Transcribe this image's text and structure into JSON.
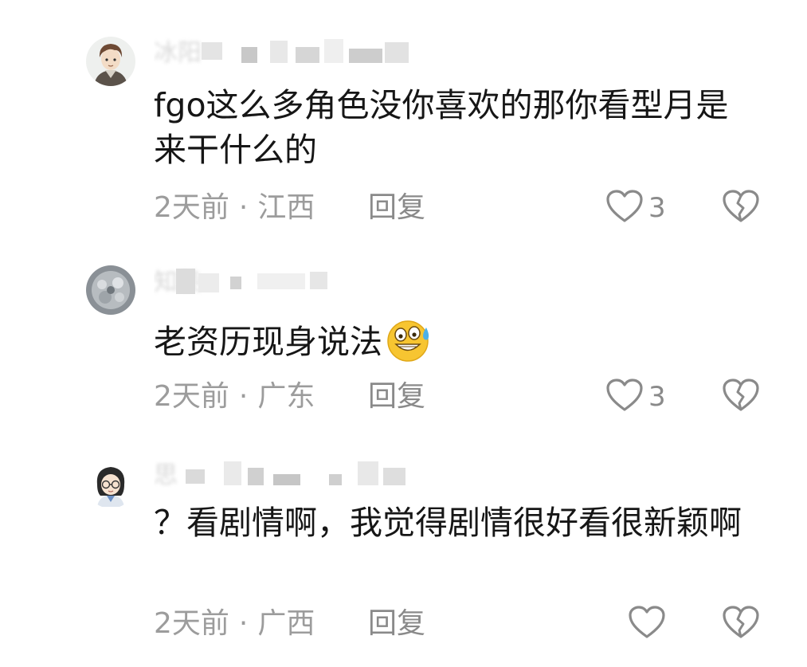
{
  "comments": [
    {
      "username": "冰阳",
      "content": "fgo这么多角色没你喜欢的那你看型月是来干什么的",
      "time": "2天前",
      "location": "江西",
      "reply_label": "回复",
      "likes": "3"
    },
    {
      "username": "知羡",
      "content": "老资历现身说法",
      "time": "2天前",
      "location": "广东",
      "reply_label": "回复",
      "likes": "3"
    },
    {
      "username": "思",
      "content": "？看剧情啊，我觉得剧情很好看很新颖啊",
      "time": "2天前",
      "location": "广西",
      "reply_label": "回复",
      "likes": ""
    }
  ],
  "icons": {
    "like": "heart-outline-icon",
    "dislike": "broken-heart-icon",
    "emoji": "sweat-smile-emoji"
  },
  "colors": {
    "text": "#161616",
    "meta": "#9c9c9c",
    "icon": "#8a8a8a",
    "username": "#b8b8b8"
  }
}
